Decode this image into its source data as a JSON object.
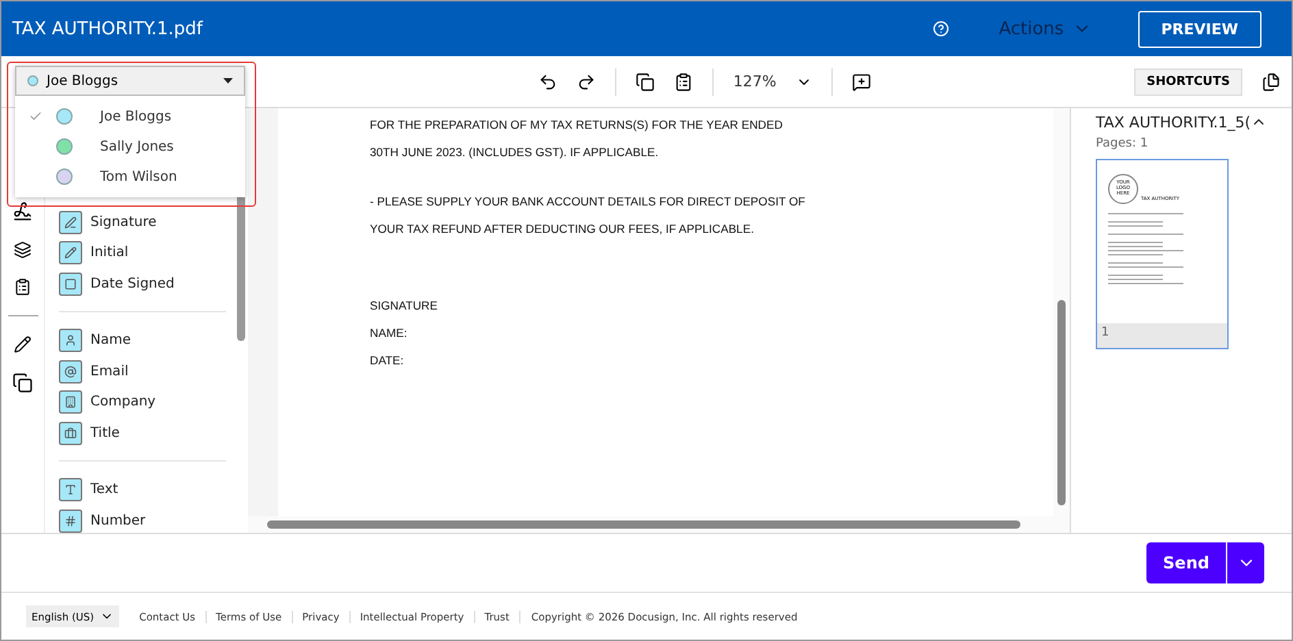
{
  "header": {
    "title": "TAX AUTHORITY.1.pdf",
    "actions_label": "Actions",
    "preview_label": "PREVIEW"
  },
  "toolbar": {
    "recipient": "Joe Bloggs",
    "zoom": "127%",
    "shortcuts_label": "SHORTCUTS"
  },
  "recipient_menu": [
    {
      "name": "Joe Bloggs",
      "selected": true,
      "color": "#a6e8f8"
    },
    {
      "name": "Sally Jones",
      "selected": false,
      "color": "#7fe0a8"
    },
    {
      "name": "Tom Wilson",
      "selected": false,
      "color": "#d9d3f2"
    }
  ],
  "field_groups": [
    [
      {
        "label": "Signature",
        "kind": "signature"
      },
      {
        "label": "Initial",
        "kind": "initial"
      },
      {
        "label": "Date Signed",
        "kind": "date"
      }
    ],
    [
      {
        "label": "Name",
        "kind": "name"
      },
      {
        "label": "Email",
        "kind": "email"
      },
      {
        "label": "Company",
        "kind": "company"
      },
      {
        "label": "Title",
        "kind": "title"
      }
    ],
    [
      {
        "label": "Text",
        "kind": "text"
      },
      {
        "label": "Number",
        "kind": "number"
      }
    ]
  ],
  "document_paragraphs": [
    [
      "FOR THE PREPARATION OF MY TAX RETURNS(S) FOR THE YEAR ENDED",
      "30TH JUNE 2023. (INCLUDES GST). IF APPLICABLE."
    ],
    [
      "- PLEASE SUPPLY YOUR BANK ACCOUNT DETAILS FOR DIRECT DEPOSIT OF",
      "YOUR TAX REFUND AFTER DEDUCTING OUR FEES, IF APPLICABLE."
    ],
    [
      "SIGNATURE",
      "NAME:",
      "DATE:"
    ]
  ],
  "pages_panel": {
    "doc_name": "TAX AUTHORITY.1_5(",
    "pages": "Pages: 1",
    "thumb_logo": "YOUR LOGO HERE",
    "thumb_title": "TAX AUTHORITY",
    "page_number": "1"
  },
  "send_label": "Send",
  "footer": {
    "language": "English (US)",
    "links": [
      "Contact Us",
      "Terms of Use",
      "Privacy",
      "Intellectual Property",
      "Trust"
    ],
    "copyright": "Copyright © 2026 Docusign, Inc. All rights reserved"
  }
}
